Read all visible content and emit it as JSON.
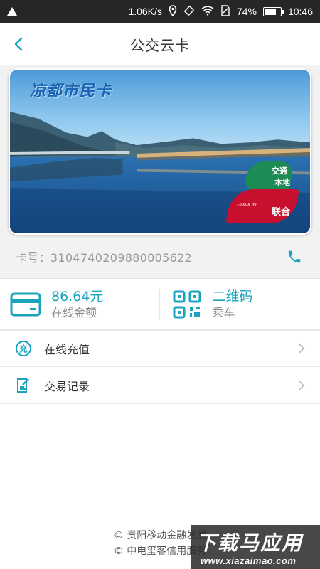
{
  "status_bar": {
    "speed": "1.06K/s",
    "battery": "74%",
    "battery_level": 0.74,
    "time": "10:46",
    "icons": [
      "warning-icon",
      "location-icon",
      "vibrate-icon",
      "wifi-icon",
      "no-sim-icon",
      "battery-icon"
    ]
  },
  "header": {
    "title": "公交云卡",
    "back_icon": "chevron-left-icon"
  },
  "card": {
    "title": "凉都市民卡",
    "badge_line1": "交通",
    "badge_line2": "本地",
    "badge_union": "联合",
    "badge_tunion": "T-UNION",
    "badge_top_color": "#1c8c55",
    "badge_bottom_color": "#c8102e"
  },
  "card_info": {
    "number_label": "卡号：3104740209880005622",
    "phone_icon": "phone-icon"
  },
  "tiles": [
    {
      "main": "86.64元",
      "sub": "在线金额",
      "icon": "card-icon"
    },
    {
      "main": "二维码",
      "sub": "乘车",
      "icon": "qr-code-icon"
    }
  ],
  "menu": [
    {
      "label": "在线充值",
      "icon": "recharge-icon"
    },
    {
      "label": "交易记录",
      "icon": "record-icon"
    }
  ],
  "footer": {
    "line1": "© 贵阳移动金融发展",
    "line2": "© 中电玺客信用服务"
  },
  "watermark": {
    "big": "下载马应用",
    "small": "www.xiazaimao.com"
  },
  "colors": {
    "accent": "#19a3bd",
    "status_bar": "#262626"
  }
}
